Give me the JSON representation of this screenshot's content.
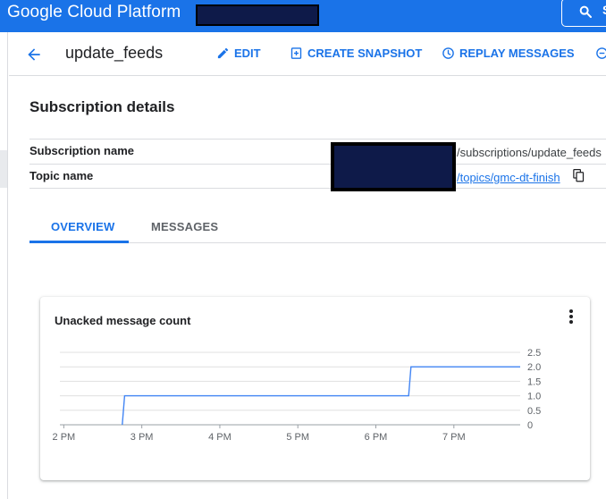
{
  "topbar": {
    "brand": "Google Cloud Platform",
    "search_label": "S"
  },
  "header": {
    "title": "update_feeds",
    "actions": {
      "edit": "EDIT",
      "create_snapshot": "CREATE SNAPSHOT",
      "replay_messages": "REPLAY MESSAGES"
    }
  },
  "details": {
    "section_title": "Subscription details",
    "subscription_name_label": "Subscription name",
    "subscription_name_value": "/subscriptions/update_feeds",
    "topic_name_label": "Topic name",
    "topic_name_value": "/topics/gmc-dt-finish"
  },
  "tabs": [
    {
      "label": "OVERVIEW",
      "active": true
    },
    {
      "label": "MESSAGES",
      "active": false
    }
  ],
  "colors": {
    "primary": "#1a73e8",
    "redaction": "#0e1a49"
  },
  "chart_data": {
    "type": "line",
    "title": "Unacked message count",
    "x_ticks": [
      "2 PM",
      "3 PM",
      "4 PM",
      "5 PM",
      "6 PM",
      "7 PM"
    ],
    "y_ticks": [
      "0",
      "0.5",
      "1.0",
      "1.5",
      "2.0",
      "2.5"
    ],
    "ylim": [
      0,
      2.5
    ],
    "xlim_hours": [
      13.95,
      19.85
    ],
    "grid": true,
    "series": [
      {
        "points": [
          {
            "x": 14.75,
            "y": 0
          },
          {
            "x": 14.78,
            "y": 1
          },
          {
            "x": 18.42,
            "y": 1
          },
          {
            "x": 18.45,
            "y": 2
          },
          {
            "x": 19.85,
            "y": 2
          }
        ]
      }
    ]
  }
}
